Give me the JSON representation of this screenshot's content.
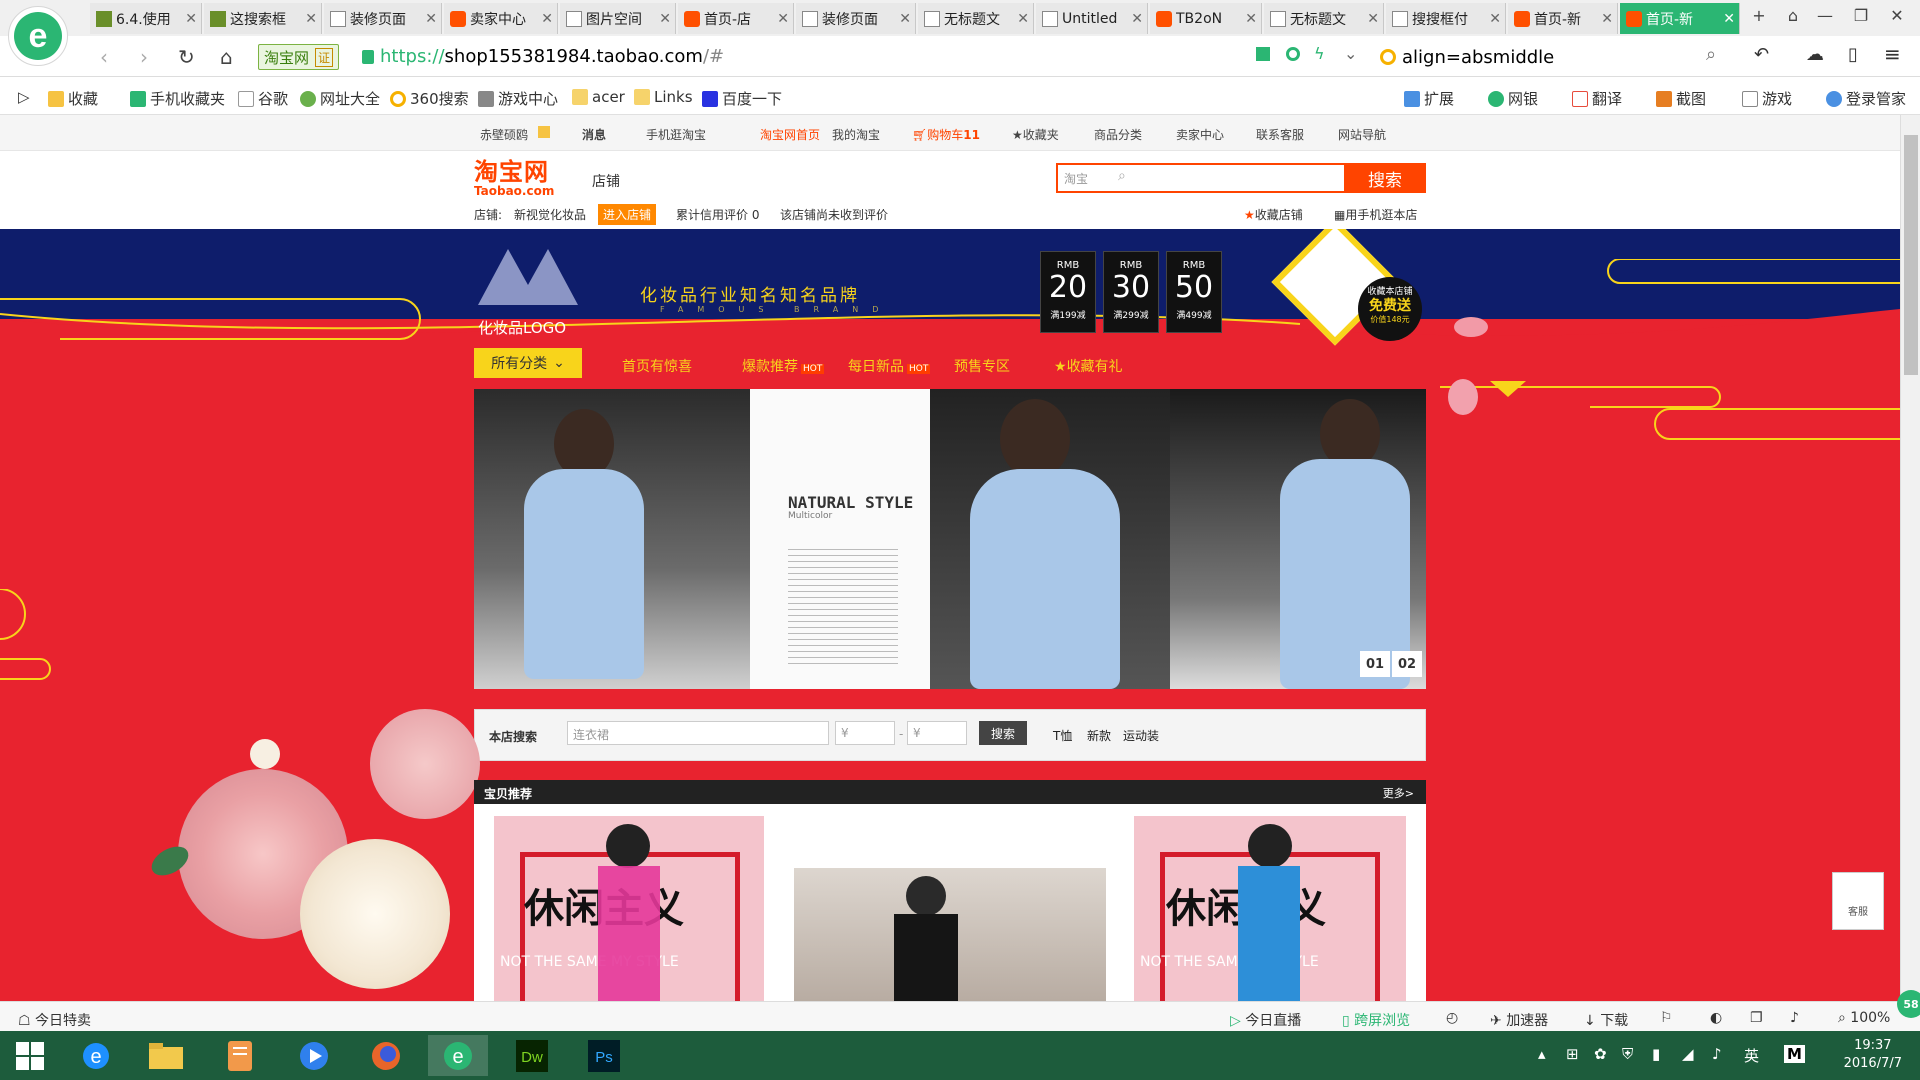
{
  "browser": {
    "tabs": [
      {
        "label": "6.4.使用",
        "icon": "grn"
      },
      {
        "label": "这搜索框",
        "icon": "grn"
      },
      {
        "label": "装修页面",
        "icon": "doc"
      },
      {
        "label": "卖家中心",
        "icon": "tao"
      },
      {
        "label": "图片空间",
        "icon": "doc"
      },
      {
        "label": "首页-店",
        "icon": "tao"
      },
      {
        "label": "装修页面",
        "icon": "doc"
      },
      {
        "label": "无标题文",
        "icon": "doc"
      },
      {
        "label": "Untitled",
        "icon": "doc"
      },
      {
        "label": "TB2oN",
        "icon": "tao"
      },
      {
        "label": "无标题文",
        "icon": "doc"
      },
      {
        "label": "搜搜框付",
        "icon": "doc"
      },
      {
        "label": "首页-新",
        "icon": "tao"
      },
      {
        "label": "首页-新",
        "icon": "tao",
        "active": true
      }
    ],
    "site_name": "淘宝网",
    "site_cert": "证",
    "url_scheme": "https://",
    "url_host": "shop155381984.taobao.com",
    "url_path": "/#",
    "search_text": "align=absmiddle",
    "bookmarks": [
      "收藏",
      "手机收藏夹",
      "谷歌",
      "网址大全",
      "360搜索",
      "游戏中心",
      "acer",
      "Links",
      "百度一下"
    ],
    "right_tools": [
      "扩展",
      "网银",
      "翻译",
      "截图",
      "游戏",
      "登录管家"
    ]
  },
  "taobao_top": {
    "user": "赤壁硕鸥",
    "msg": "消息",
    "mobile": "手机逛淘宝",
    "home": "淘宝网首页",
    "my": "我的淘宝",
    "cart": "购物车",
    "cart_count": "11",
    "fav": "收藏夹",
    "cat": "商品分类",
    "seller": "卖家中心",
    "service": "联系客服",
    "sitenav": "网站导航"
  },
  "header": {
    "logo_cn": "淘宝网",
    "logo_en": "Taobao.com",
    "shop_label": "店铺",
    "search_scope": "淘宝",
    "search_button": "搜索",
    "shop_prefix": "店铺:",
    "shop_name": "新视觉化妆品",
    "enter_shop": "进入店铺",
    "credit": "累计信用评价 0",
    "no_review": "该店铺尚未收到评价",
    "collect": "收藏店铺",
    "mobile_shop": "用手机逛本店"
  },
  "store": {
    "logo_text": "化妆品LOGO",
    "slogan": "化妆品行业知名知名品牌",
    "slogan_en": "FAMOUS BRAND",
    "coupons": [
      {
        "rmb": "RMB",
        "value": "20",
        "cond": "满199减"
      },
      {
        "rmb": "RMB",
        "value": "30",
        "cond": "满299减"
      },
      {
        "rmb": "RMB",
        "value": "50",
        "cond": "满499减"
      }
    ],
    "gift_line1": "收藏本店铺",
    "gift_line2": "免费送",
    "gift_line3": "价值148元",
    "nav": {
      "all": "所有分类",
      "items": [
        "首页有惊喜",
        "爆款推荐",
        "每日新品",
        "预售专区",
        "收藏有礼"
      ],
      "hot": "HOT"
    },
    "banner": {
      "title": "NATURAL STYLE",
      "subtitle": "Multicolor",
      "dots": [
        "01",
        "02"
      ]
    },
    "shop_search": {
      "label": "本店搜索",
      "placeholder": "连衣裙",
      "min": "¥",
      "max": "¥",
      "dash": "-",
      "button": "搜索",
      "hotwords": [
        "T恤",
        "新款",
        "运动装"
      ]
    },
    "recommend": {
      "title": "宝贝推荐",
      "more": "更多>",
      "promo": "休闲主义",
      "promo_en": "NOT THE SAME MY STYLE"
    },
    "kefu": "客服"
  },
  "statusbar": {
    "today": "今日特卖",
    "live": "今日直播",
    "cross": "跨屏浏览",
    "accel": "加速器",
    "download": "下载",
    "zoom": "100%",
    "badge": "58"
  },
  "taskbar": {
    "time": "19:37",
    "date": "2016/7/7",
    "ime": "英",
    "m": "M"
  }
}
